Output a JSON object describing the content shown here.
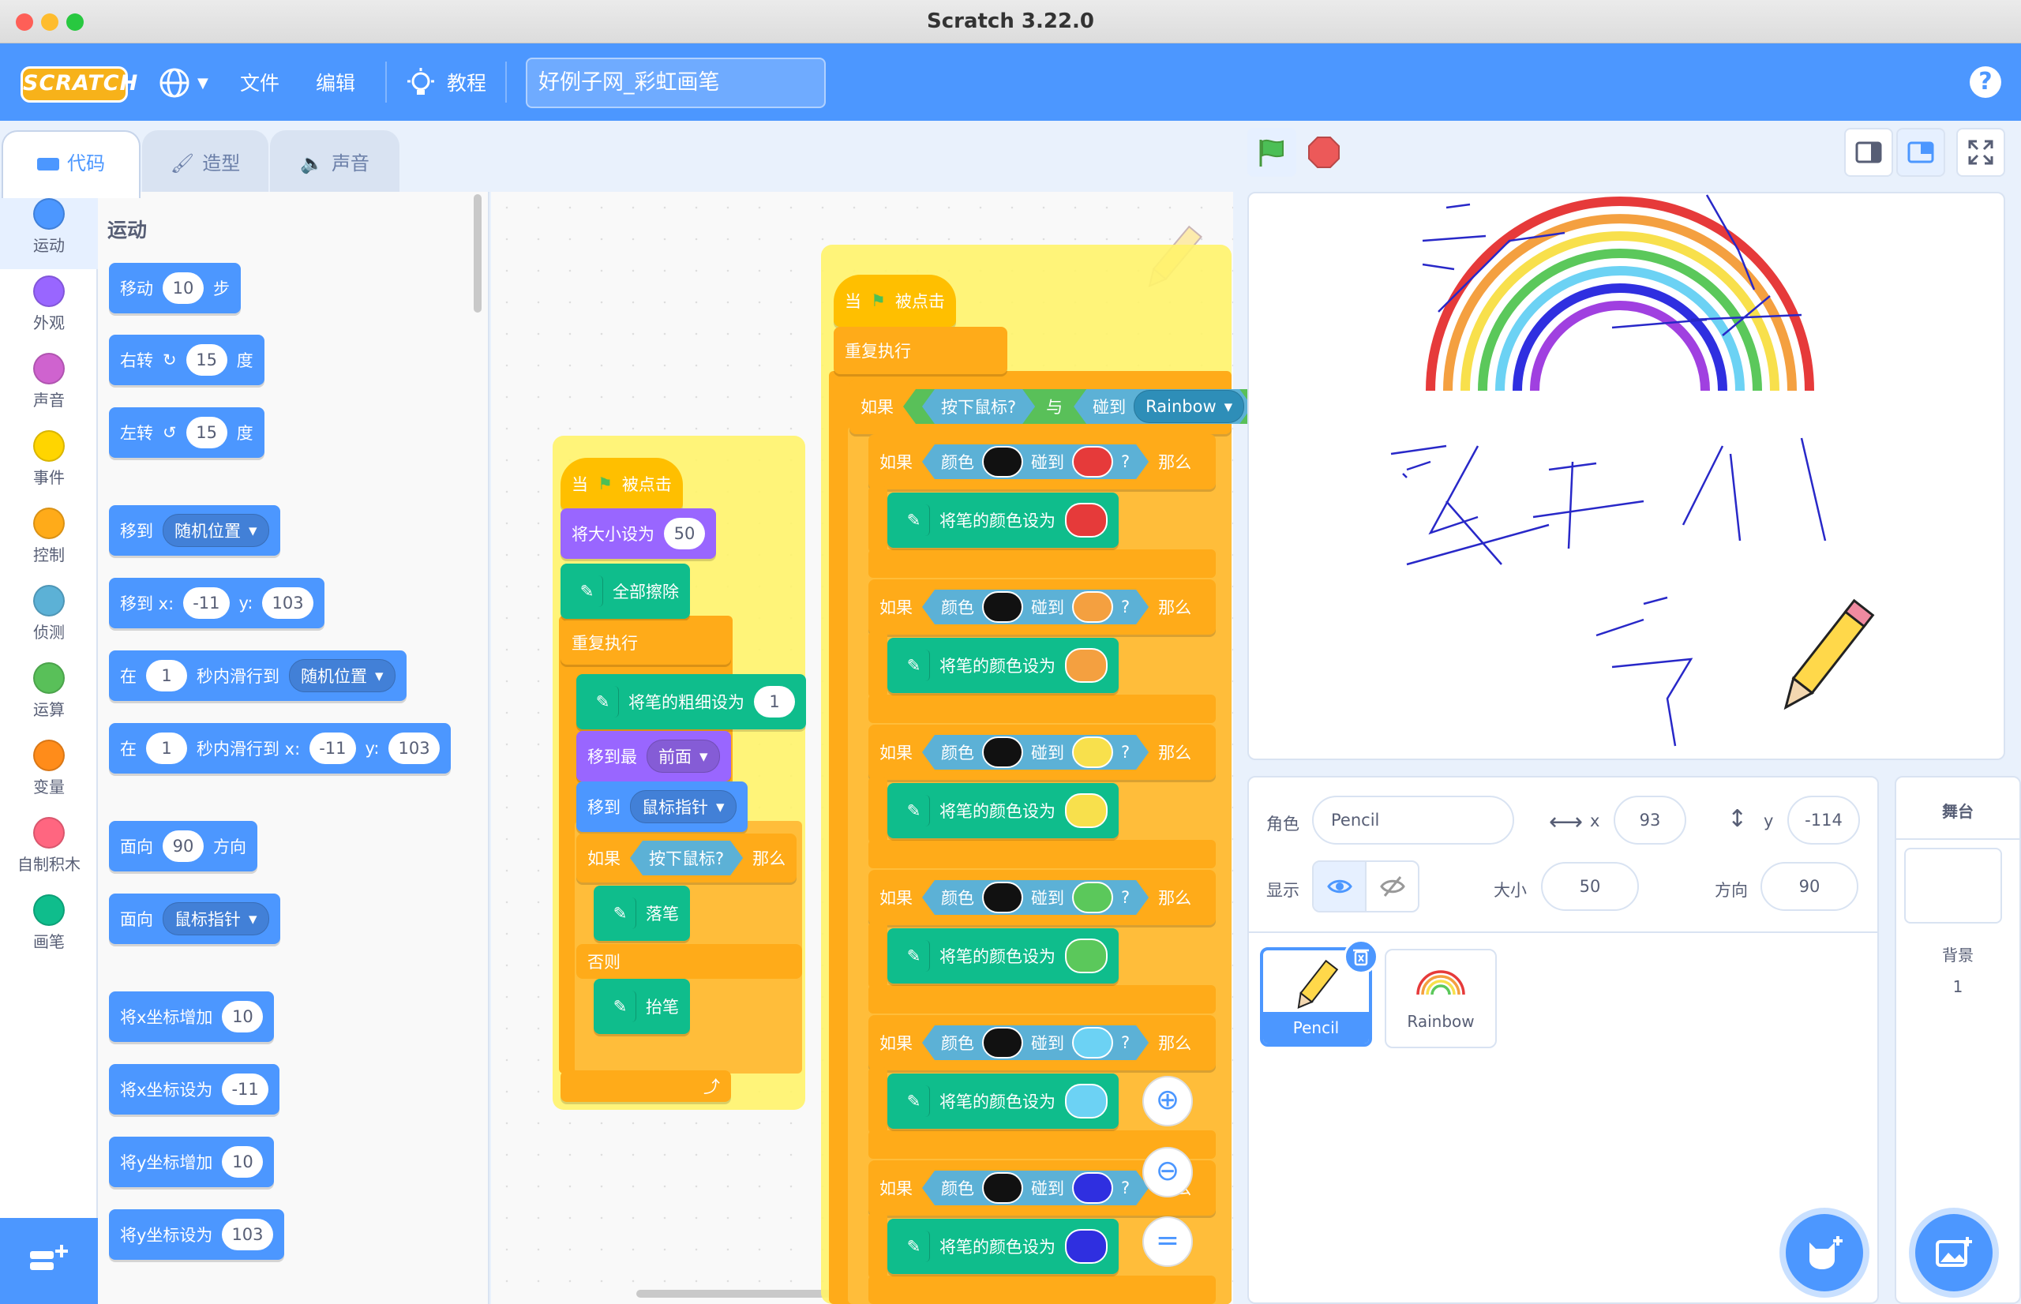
{
  "window": {
    "title": "Scratch 3.22.0"
  },
  "menu": {
    "logo": "SCRATCH",
    "file": "文件",
    "edit": "编辑",
    "tutorials": "教程",
    "project_title": "好例子网_彩虹画笔",
    "help": "?"
  },
  "tabs": {
    "code": "代码",
    "costumes": "造型",
    "sounds": "声音"
  },
  "categories": [
    {
      "label": "运动",
      "color": "#4c97ff"
    },
    {
      "label": "外观",
      "color": "#9966ff"
    },
    {
      "label": "声音",
      "color": "#cf63cf"
    },
    {
      "label": "事件",
      "color": "#ffd500"
    },
    {
      "label": "控制",
      "color": "#ffab19"
    },
    {
      "label": "侦测",
      "color": "#5cb1d6"
    },
    {
      "label": "运算",
      "color": "#59c059"
    },
    {
      "label": "变量",
      "color": "#ff8c1a"
    },
    {
      "label": "自制积木",
      "color": "#ff6680"
    },
    {
      "label": "画笔",
      "color": "#0fbd8c"
    }
  ],
  "palette": {
    "heading": "运动",
    "move": {
      "pre": "移动",
      "val": "10",
      "post": "步"
    },
    "turn_right": {
      "pre": "右转",
      "val": "15",
      "post": "度"
    },
    "turn_left": {
      "pre": "左转",
      "val": "15",
      "post": "度"
    },
    "goto_random": {
      "pre": "移到",
      "dd": "随机位置"
    },
    "goto_xy": {
      "pre": "移到 x:",
      "x": "-11",
      "ylab": "y:",
      "y": "103"
    },
    "glide_random": {
      "pre": "在",
      "val": "1",
      "mid": "秒内滑行到",
      "dd": "随机位置"
    },
    "glide_xy": {
      "pre": "在",
      "val": "1",
      "mid": "秒内滑行到 x:",
      "x": "-11",
      "ylab": "y:",
      "y": "103"
    },
    "point_dir": {
      "pre": "面向",
      "val": "90",
      "post": "方向"
    },
    "point_towards": {
      "pre": "面向",
      "dd": "鼠标指针"
    },
    "change_x": {
      "pre": "将x坐标增加",
      "val": "10"
    },
    "set_x": {
      "pre": "将x坐标设为",
      "val": "-11"
    },
    "change_y": {
      "pre": "将y坐标增加",
      "val": "10"
    },
    "set_y": {
      "pre": "将y坐标设为",
      "val": "103"
    }
  },
  "script1": {
    "hat": {
      "pre": "当",
      "post": "被点击"
    },
    "set_size": {
      "pre": "将大小设为",
      "val": "50"
    },
    "clear": "全部擦除",
    "forever": "重复执行",
    "pen_size": {
      "pre": "将笔的粗细设为",
      "val": "1"
    },
    "front": {
      "pre": "移到最",
      "dd": "前面"
    },
    "goto": {
      "pre": "移到",
      "dd": "鼠标指针"
    },
    "if": {
      "pre": "如果",
      "cond": "按下鼠标?",
      "post": "那么"
    },
    "pen_down": "落笔",
    "else": "否则",
    "pen_up": "抬笔"
  },
  "script2": {
    "hat": {
      "pre": "当",
      "post": "被点击"
    },
    "forever": "重复执行",
    "if_outer": {
      "pre": "如果",
      "cond1": "按下鼠标?",
      "and": "与",
      "touch": "碰到",
      "dd": "Rainbow"
    },
    "if_color": {
      "pre": "如果",
      "color": "颜色",
      "touch": "碰到",
      "q": "?",
      "then": "那么"
    },
    "set_color": "将笔的颜色设为",
    "colors": [
      "#e63a3a",
      "#f4a040",
      "#f8e04c",
      "#5bc85b",
      "#6cd2f4",
      "#2f2fe0"
    ]
  },
  "sprite_info": {
    "sprite_label": "角色",
    "sprite_name": "Pencil",
    "x_label": "x",
    "x": "93",
    "y_label": "y",
    "y": "-114",
    "show_label": "显示",
    "size_label": "大小",
    "size": "50",
    "dir_label": "方向",
    "direction": "90"
  },
  "sprites": [
    {
      "name": "Pencil"
    },
    {
      "name": "Rainbow"
    }
  ],
  "stage_panel": {
    "title": "舞台",
    "backdrop_label": "背景",
    "backdrop_count": "1"
  }
}
